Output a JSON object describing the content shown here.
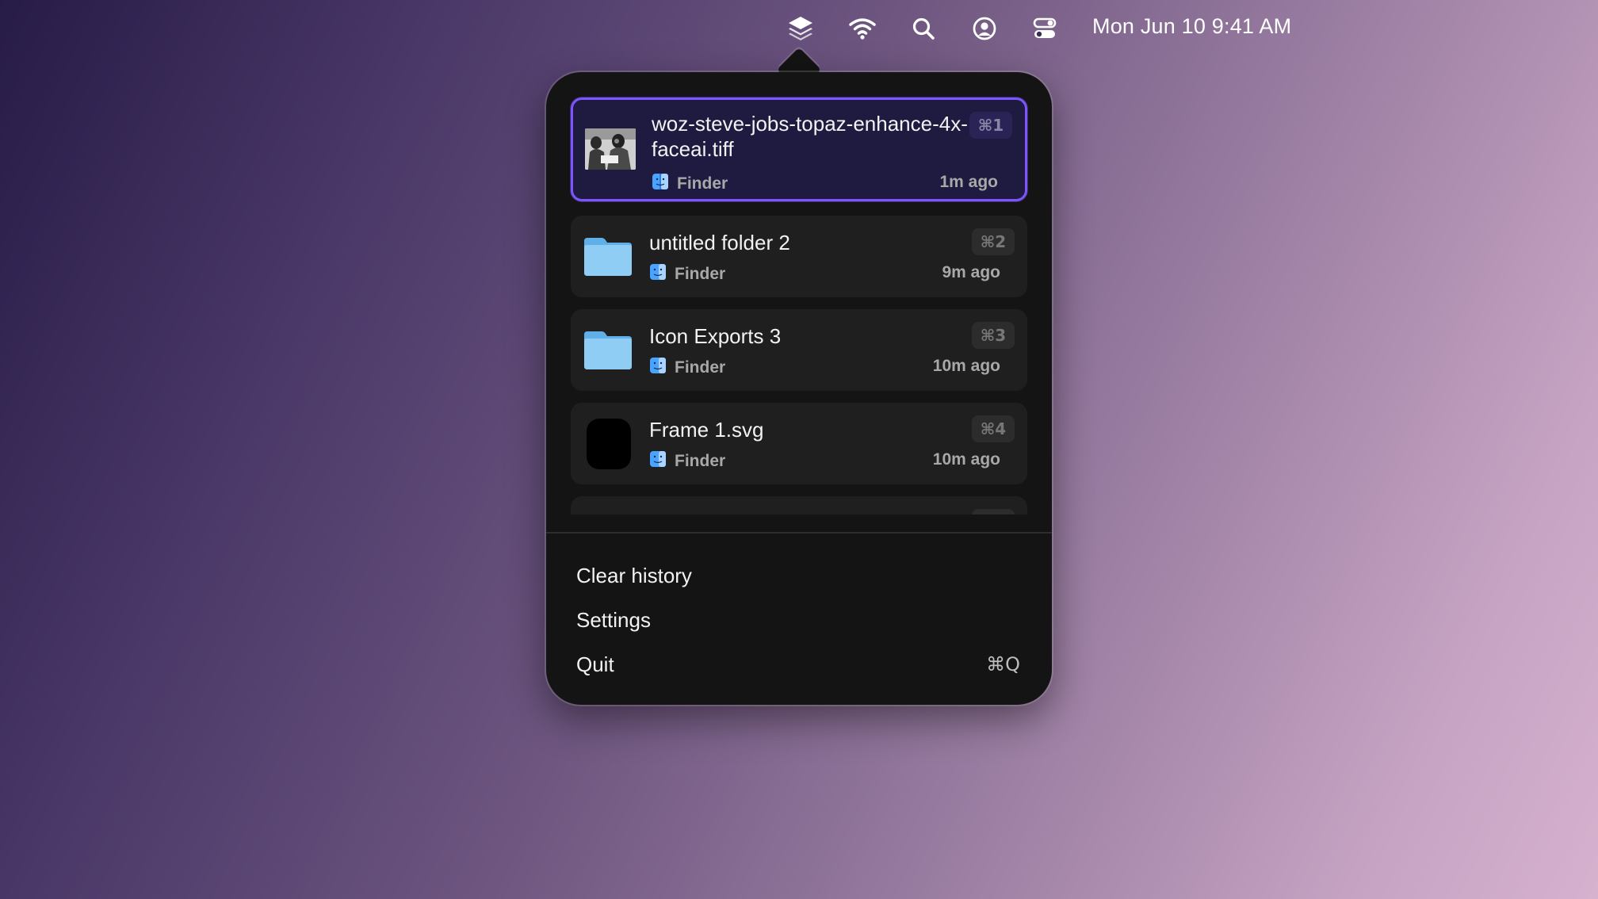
{
  "menubar": {
    "icons": [
      "stack-icon",
      "wifi-icon",
      "search-icon",
      "user-icon",
      "control-center-icon"
    ],
    "clock": "Mon Jun 10  9:41 AM"
  },
  "history": {
    "items": [
      {
        "title": "woz-steve-jobs-topaz-enhance-4x-faceai.tiff",
        "app": "Finder",
        "time": "1m ago",
        "shortcut": "⌘1",
        "thumb": "photo-thumbnail",
        "selected": true
      },
      {
        "title": "untitled folder 2",
        "app": "Finder",
        "time": "9m ago",
        "shortcut": "⌘2",
        "thumb": "folder-icon"
      },
      {
        "title": "Icon Exports 3",
        "app": "Finder",
        "time": "10m ago",
        "shortcut": "⌘3",
        "thumb": "folder-icon"
      },
      {
        "title": "Frame 1.svg",
        "app": "Finder",
        "time": "10m ago",
        "shortcut": "⌘4",
        "thumb": "svg-file-icon"
      }
    ]
  },
  "menu": {
    "clear_history": "Clear history",
    "settings": "Settings",
    "quit": "Quit",
    "quit_shortcut": "⌘Q"
  },
  "colors": {
    "accent": "#7c55ff",
    "popover_bg": "#141414",
    "folder_blue": "#7fc3f0"
  }
}
